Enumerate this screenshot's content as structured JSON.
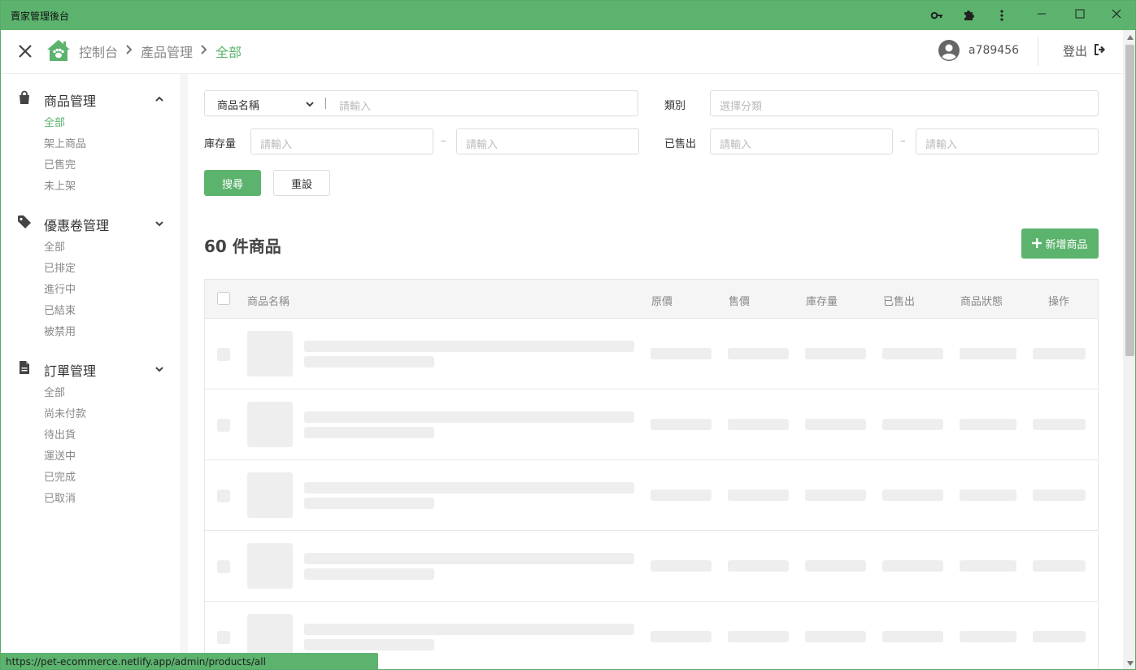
{
  "window": {
    "title": "賣家管理後台",
    "toolbar_icons": [
      "key-icon",
      "puzzle-icon",
      "more-vertical-icon"
    ],
    "controls": [
      "minimize-icon",
      "maximize-icon",
      "close-icon"
    ]
  },
  "header": {
    "breadcrumb": [
      "控制台",
      "產品管理",
      "全部"
    ],
    "username": "a789456",
    "logout_label": "登出",
    "colors": {
      "accent": "#5cb36e"
    }
  },
  "sidebar": {
    "groups": [
      {
        "label": "商品管理",
        "icon": "shopping-bag-icon",
        "expanded": true,
        "items": [
          "全部",
          "架上商品",
          "已售完",
          "未上架"
        ],
        "active_index": 0
      },
      {
        "label": "優惠卷管理",
        "icon": "tag-icon",
        "expanded": false,
        "items": [
          "全部",
          "已排定",
          "進行中",
          "已結束",
          "被禁用"
        ]
      },
      {
        "label": "訂單管理",
        "icon": "document-icon",
        "expanded": false,
        "items": [
          "全部",
          "尚未付款",
          "待出貨",
          "運送中",
          "已完成",
          "已取消"
        ]
      }
    ]
  },
  "filters": {
    "name_select": "商品名稱",
    "name_placeholder": "請輸入",
    "category_label": "類別",
    "category_placeholder": "選擇分類",
    "stock_label": "庫存量",
    "sold_label": "已售出",
    "range_placeholder": "請輸入",
    "range_sep": "–",
    "search_button": "搜尋",
    "reset_button": "重設"
  },
  "products": {
    "count_title": "60 件商品",
    "add_button": "新增商品",
    "columns": [
      "商品名稱",
      "原價",
      "售價",
      "庫存量",
      "已售出",
      "商品狀態",
      "操作"
    ],
    "loading_rows": 5
  },
  "status_bar": {
    "url": "https://pet-ecommerce.netlify.app/admin/products/all"
  }
}
